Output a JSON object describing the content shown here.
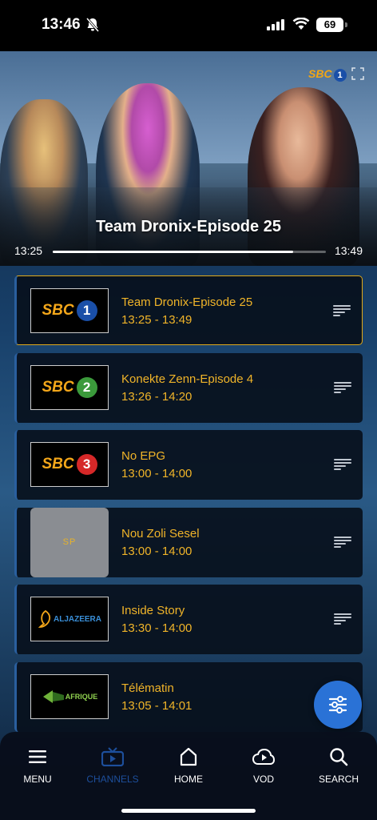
{
  "status_bar": {
    "time": "13:46",
    "battery": "69",
    "icons": [
      "bell-off-icon",
      "signal-icon",
      "wifi-icon",
      "battery-icon"
    ]
  },
  "player": {
    "title": "Team Dronix-Episode 25",
    "start_time": "13:25",
    "end_time": "13:49",
    "progress": 0.88,
    "watermark": {
      "brand": "SBC",
      "number": "1"
    }
  },
  "channels": [
    {
      "logo_type": "sbc",
      "logo_brand": "SBC",
      "logo_number": "1",
      "logo_color": "#1a4fa8",
      "title": "Team Dronix-Episode 25",
      "time": "13:25 - 13:49",
      "active": true
    },
    {
      "logo_type": "sbc",
      "logo_brand": "SBC",
      "logo_number": "2",
      "logo_color": "#3b9a3b",
      "title": "Konekte Zenn-Episode 4",
      "time": "13:26 - 14:20",
      "active": false
    },
    {
      "logo_type": "sbc",
      "logo_brand": "SBC",
      "logo_number": "3",
      "logo_color": "#d62828",
      "title": "No EPG",
      "time": "13:00 - 14:00",
      "active": false
    },
    {
      "logo_type": "placeholder",
      "logo_text": "SP",
      "title": "Nou Zoli Sesel",
      "time": "13:00 - 14:00",
      "active": false
    },
    {
      "logo_type": "aljazeera",
      "logo_text": "ALJAZEERA",
      "title": "Inside Story",
      "time": "13:30 - 14:00",
      "active": false
    },
    {
      "logo_type": "afrique",
      "logo_text": "AFRIQUE",
      "title": "Télématin",
      "time": "13:05 - 14:01",
      "active": false
    }
  ],
  "nav": {
    "items": [
      {
        "label": "MENU",
        "icon": "hamburger-icon"
      },
      {
        "label": "CHANNELS",
        "icon": "tv-icon",
        "active": true
      },
      {
        "label": "HOME",
        "icon": "home-icon"
      },
      {
        "label": "VOD",
        "icon": "play-cloud-icon"
      },
      {
        "label": "SEARCH",
        "icon": "search-icon"
      }
    ]
  },
  "colors": {
    "accent": "#f0b429",
    "active_border": "#e0a91a",
    "fab": "#2a72d6",
    "nav_active": "#1d4f9c"
  }
}
